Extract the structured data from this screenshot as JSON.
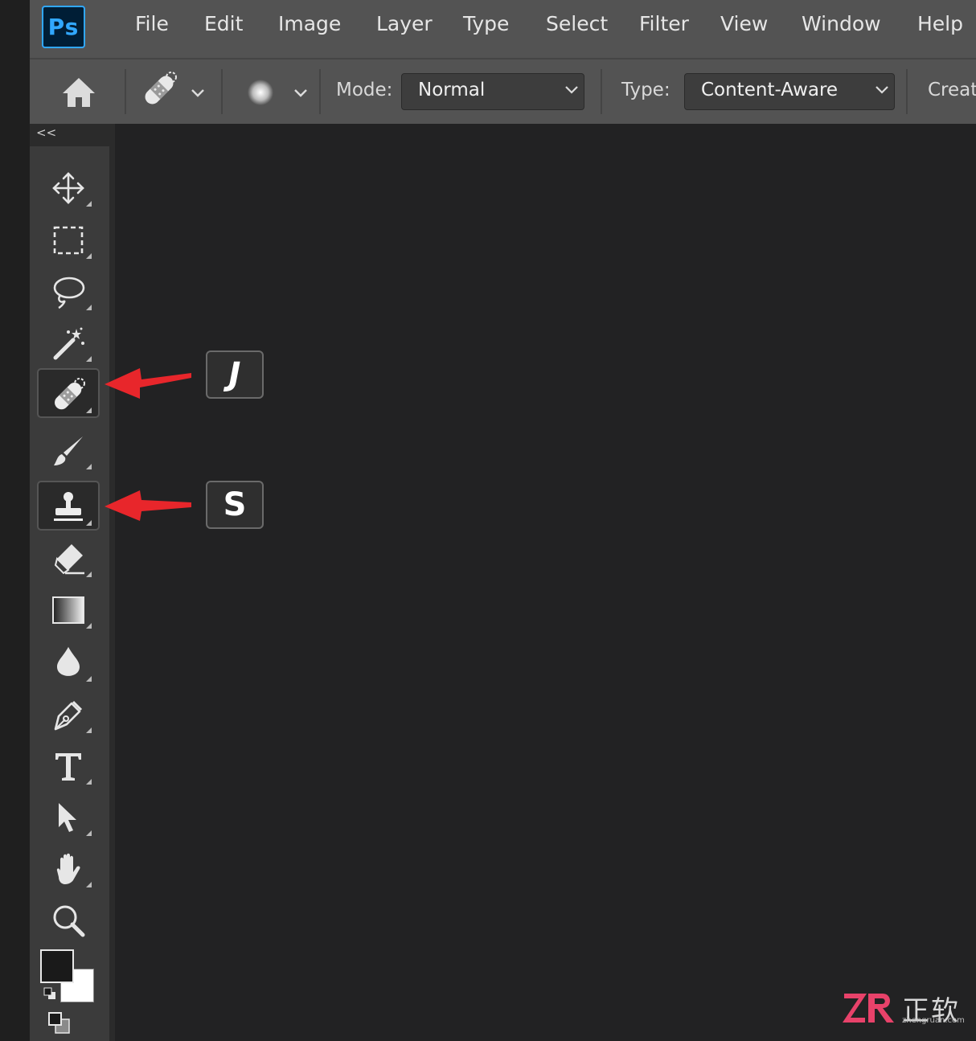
{
  "app": {
    "logo_text": "Ps"
  },
  "menu": {
    "items": [
      "File",
      "Edit",
      "Image",
      "Layer",
      "Type",
      "Select",
      "Filter",
      "View",
      "Window",
      "Help"
    ]
  },
  "options_bar": {
    "mode_label": "Mode:",
    "mode_value": "Normal",
    "type_label": "Type:",
    "type_value": "Content-Aware",
    "create_label": "Create"
  },
  "toolbar": {
    "collapse_label": "<<",
    "tools": [
      {
        "name": "move-tool",
        "icon": "move-icon"
      },
      {
        "name": "rectangular-marquee-tool",
        "icon": "marquee-icon"
      },
      {
        "name": "lasso-tool",
        "icon": "lasso-icon"
      },
      {
        "name": "magic-wand-tool",
        "icon": "magic-wand-icon"
      },
      {
        "name": "spot-healing-brush-tool",
        "icon": "bandage-icon",
        "selected": true
      },
      {
        "name": "brush-tool",
        "icon": "brush-icon"
      },
      {
        "name": "clone-stamp-tool",
        "icon": "stamp-icon",
        "selected": true
      },
      {
        "name": "eraser-tool",
        "icon": "eraser-icon"
      },
      {
        "name": "gradient-tool",
        "icon": "gradient-icon"
      },
      {
        "name": "blur-tool",
        "icon": "drop-icon"
      },
      {
        "name": "pen-tool",
        "icon": "pen-icon"
      },
      {
        "name": "type-tool",
        "icon": "type-icon"
      },
      {
        "name": "path-selection-tool",
        "icon": "arrow-icon"
      },
      {
        "name": "hand-tool",
        "icon": "hand-icon"
      },
      {
        "name": "zoom-tool",
        "icon": "zoom-icon"
      }
    ]
  },
  "annotations": {
    "key_j": "J",
    "key_s": "S",
    "arrow_color": "#e8262b"
  },
  "watermark": {
    "chinese": "正软",
    "url": "zhengruan.com"
  }
}
